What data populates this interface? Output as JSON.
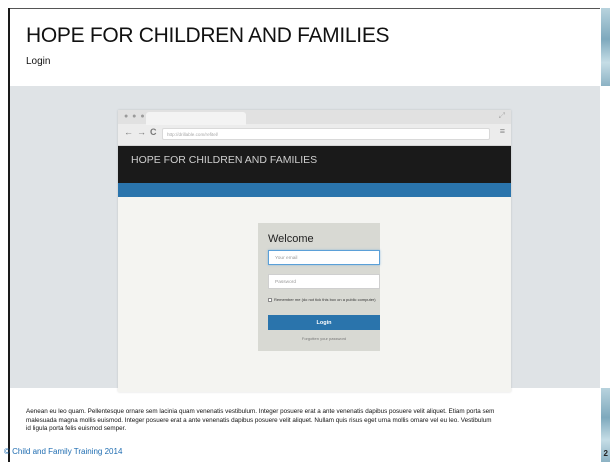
{
  "slide": {
    "title": "HOPE FOR CHILDREN AND FAMILIES",
    "subtitle": "Login",
    "body_text": "Aenean eu leo quam. Pellentesque ornare sem lacinia quam venenatis vestibulum. Integer posuere erat a ante venenatis dapibus posuere velit aliquet. Etiam porta sem malesuada magna mollis euismod. Integer posuere erat a ante venenatis dapibus posuere velit aliquet. Nullam quis risus eget urna mollis ornare vel eu leo. Vestibulum id ligula porta felis euismod semper.",
    "footer": "© Child and Family Training 2014",
    "page_number": "2"
  },
  "browser": {
    "window_dots": "● ● ●",
    "back_icon": "←",
    "forward_icon": "→",
    "reload_icon": "C",
    "address": "http://drillable.com/refitel/",
    "menu_icon": "≡",
    "expand_icon": "⤢"
  },
  "site": {
    "title": "HOPE FOR CHILDREN AND FAMILIES"
  },
  "login": {
    "heading": "Welcome",
    "email_placeholder": "Your email",
    "password_placeholder": "Password",
    "remember_label": "Remember me (do not tick this box on a public computer)",
    "button_label": "Login",
    "forgot_label": "Forgotten your password"
  },
  "colors": {
    "nav_bar": "#2a74ac",
    "site_header": "#1a1a1a",
    "footer_text": "#1f6db1"
  }
}
